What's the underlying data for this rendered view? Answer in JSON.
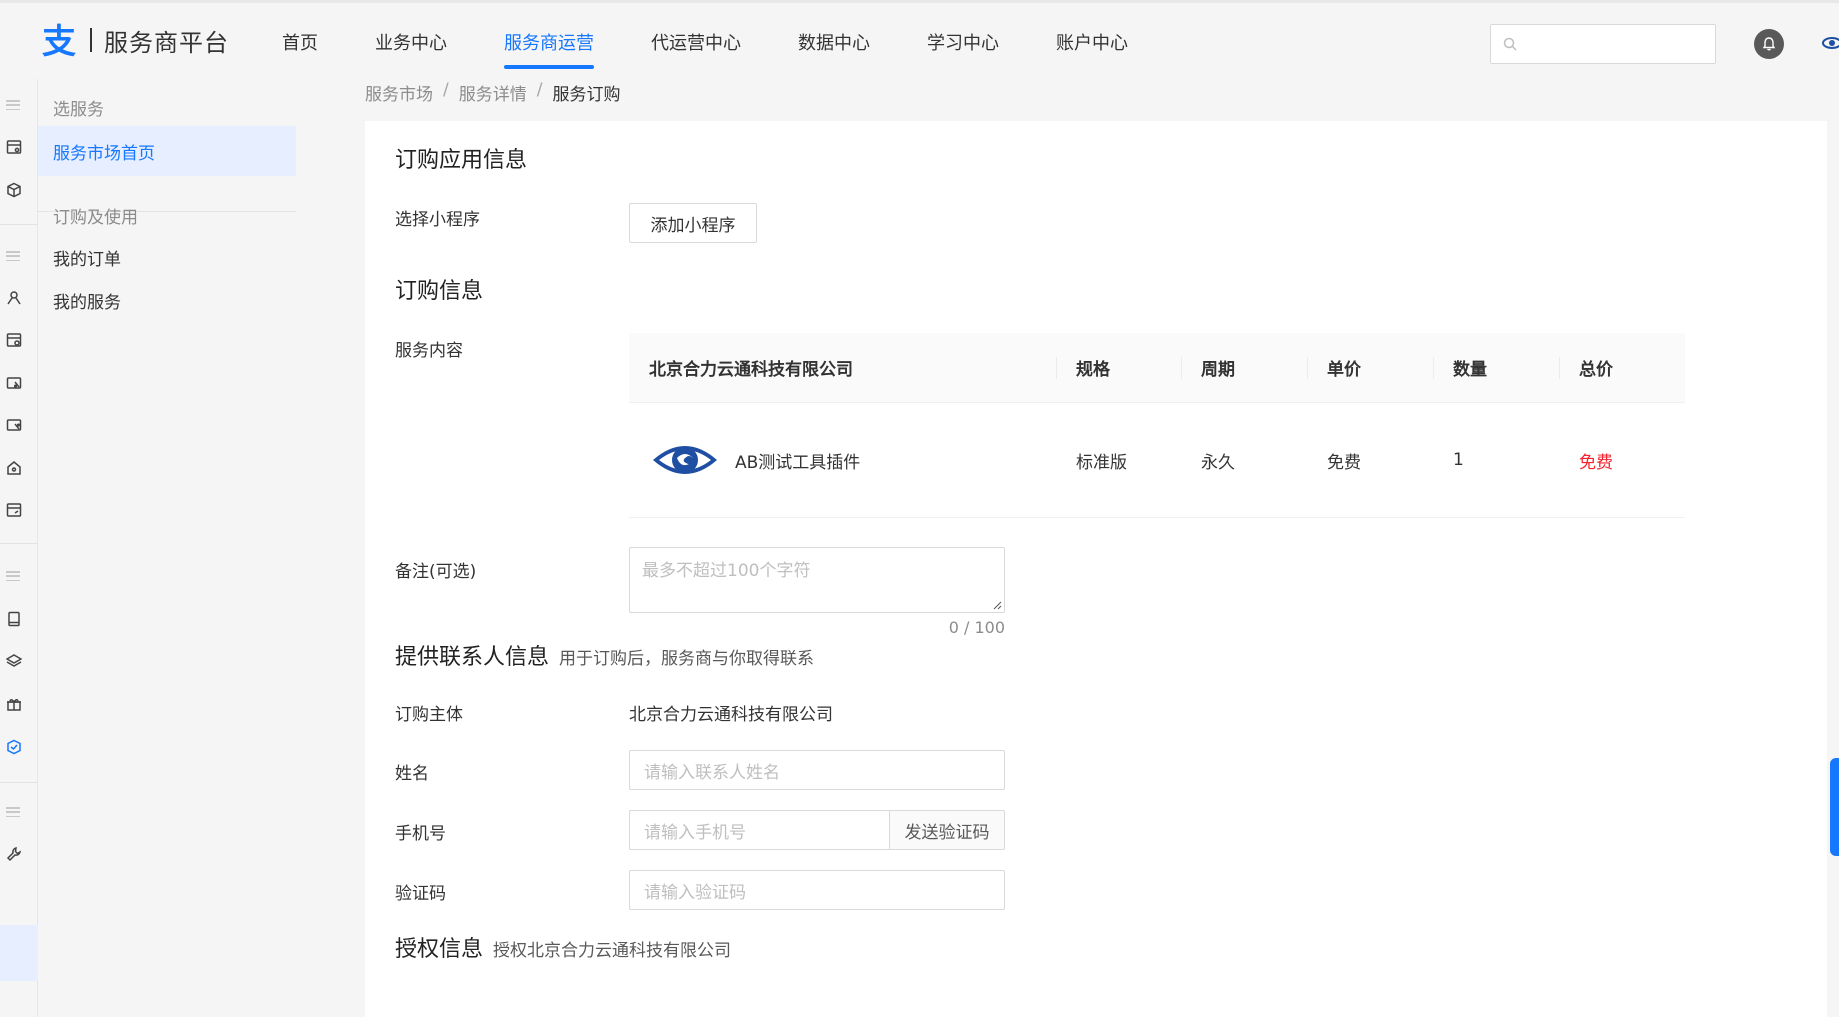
{
  "brand": {
    "name": "服务商平台",
    "accent": "#1677ff"
  },
  "nav": {
    "items": [
      {
        "label": "首页",
        "active": false
      },
      {
        "label": "业务中心",
        "active": false
      },
      {
        "label": "服务商运营",
        "active": true
      },
      {
        "label": "代运营中心",
        "active": false
      },
      {
        "label": "数据中心",
        "active": false
      },
      {
        "label": "学习中心",
        "active": false
      },
      {
        "label": "账户中心",
        "active": false
      }
    ],
    "search_placeholder": ""
  },
  "sidebar": {
    "group1": "选服务",
    "item_market_home": "服务市场首页",
    "group2": "订购及使用",
    "item_my_orders": "我的订单",
    "item_my_services": "我的服务"
  },
  "breadcrumb": {
    "b1": "服务市场",
    "b2": "服务详情",
    "b3": "服务订购",
    "sep": "/"
  },
  "app_info": {
    "title": "订购应用信息",
    "select_label": "选择小程序",
    "add_button": "添加小程序"
  },
  "order_info": {
    "title": "订购信息",
    "content_label": "服务内容",
    "table": {
      "headers": [
        "北京合力云通科技有限公司",
        "规格",
        "周期",
        "单价",
        "数量",
        "总价"
      ],
      "rows": [
        {
          "name": "AB测试工具插件",
          "spec": "标准版",
          "period": "永久",
          "unit_price": "免费",
          "qty": "1",
          "total": "免费",
          "logo": "eye-logo-icon"
        }
      ]
    },
    "remark_label": "备注(可选)",
    "remark_placeholder": "最多不超过100个字符",
    "remark_counter": "0 / 100"
  },
  "contact": {
    "title": "提供联系人信息",
    "subtitle": "用于订购后，服务商与你取得联系",
    "subject_label": "订购主体",
    "subject_value": "北京合力云通科技有限公司",
    "name_label": "姓名",
    "name_placeholder": "请输入联系人姓名",
    "phone_label": "手机号",
    "phone_placeholder": "请输入手机号",
    "send_code": "发送验证码",
    "code_label": "验证码",
    "code_placeholder": "请输入验证码"
  },
  "auth": {
    "title": "授权信息",
    "subtitle": "授权北京合力云通科技有限公司"
  },
  "colors": {
    "accent": "#1677ff",
    "danger": "#f5222d",
    "bg": "#f5f5f5"
  }
}
